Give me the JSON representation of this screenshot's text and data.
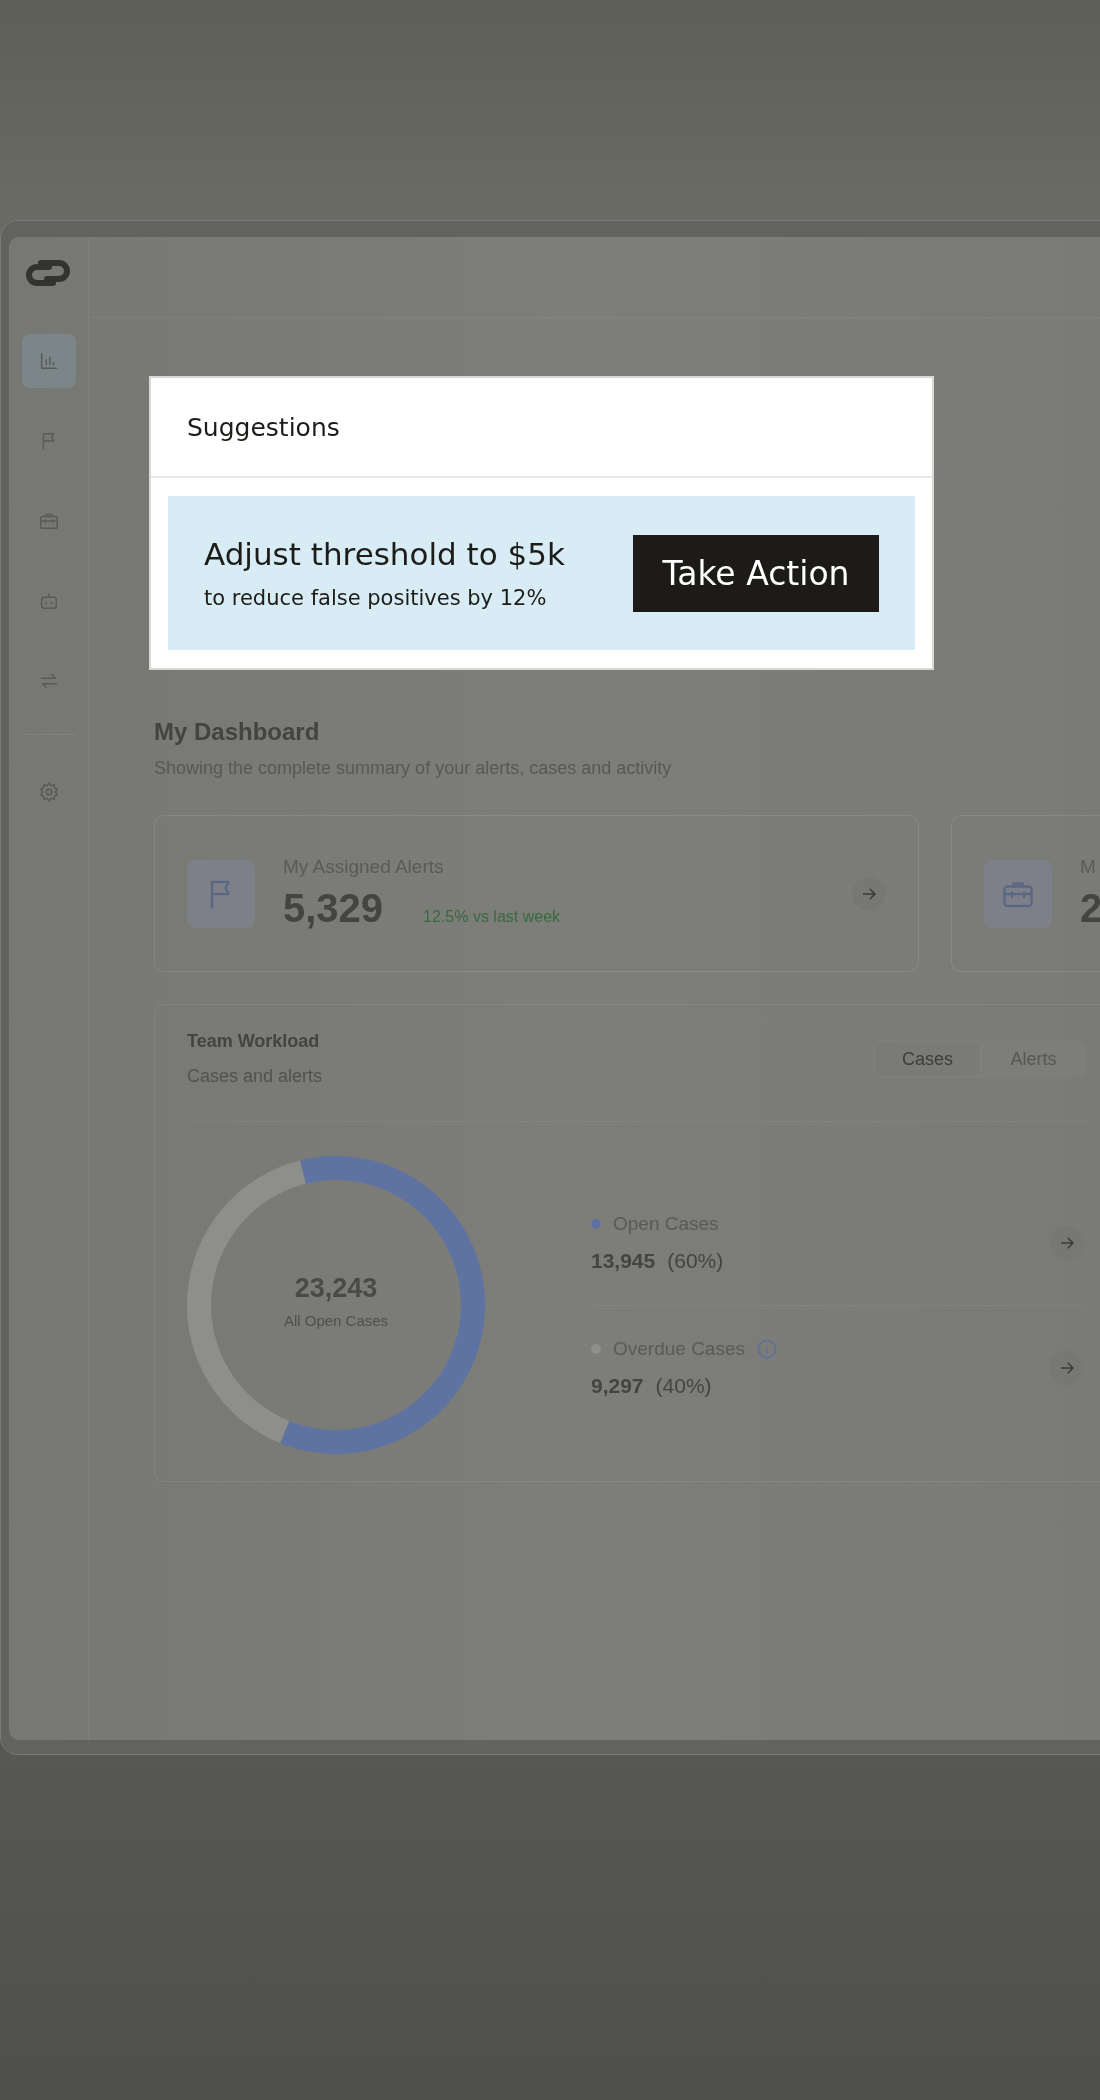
{
  "sidebar": {
    "items": [
      {
        "kind": "chart",
        "selected": true
      },
      {
        "kind": "flag",
        "selected": false
      },
      {
        "kind": "briefcase",
        "selected": false
      },
      {
        "kind": "robot",
        "selected": false
      },
      {
        "kind": "transfer",
        "selected": false
      }
    ],
    "footer_items": [
      {
        "kind": "settings",
        "selected": false
      }
    ]
  },
  "suggestions": {
    "title": "Suggestions",
    "headline": "Adjust threshold to $5k",
    "detail": "to reduce false positives by 12%",
    "action": "Take Action"
  },
  "dashboard": {
    "title": "My Dashboard",
    "subtitle": "Showing the complete summary of your alerts, cases and activity"
  },
  "stat_cards": [
    {
      "kind": "flag",
      "label": "My Assigned Alerts",
      "value": "5,329",
      "change": "12.5% vs last week"
    },
    {
      "kind": "briefcase",
      "label": "M",
      "value": "2"
    }
  ],
  "team_workload": {
    "title": "Team Workload",
    "subtitle": "Cases and alerts",
    "tabs": [
      {
        "label": "Cases",
        "selected": true
      },
      {
        "label": "Alerts",
        "selected": false
      }
    ],
    "total": "23,243",
    "total_label": "All Open Cases",
    "chart_data": {
      "type": "donut",
      "categories": [
        "Open Cases",
        "Overdue Cases"
      ],
      "values": [
        60,
        40
      ]
    },
    "legend": [
      {
        "count": "13,945",
        "share": "(60%)",
        "color": "#5f73a3",
        "info": false
      },
      {
        "count": "9,297",
        "share": "(40%)",
        "color": "#8e8e8a",
        "info": true
      }
    ]
  }
}
